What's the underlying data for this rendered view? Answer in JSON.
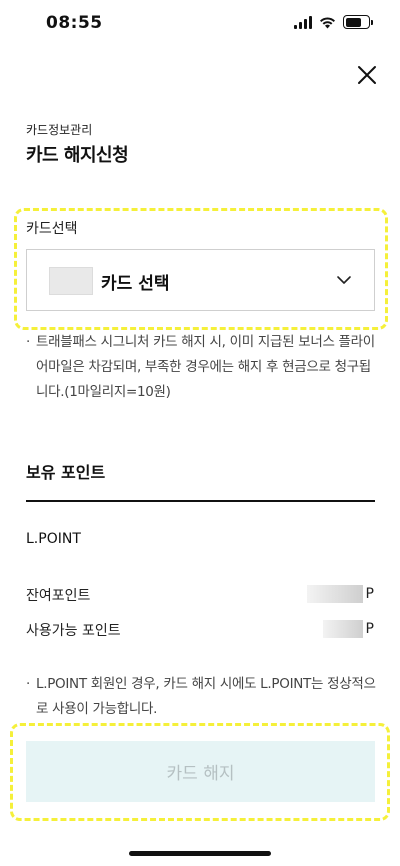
{
  "status_bar": {
    "time": "08:55"
  },
  "header": {
    "breadcrumb": "카드정보관리",
    "title": "카드 해지신청"
  },
  "card_select": {
    "label": "카드선택",
    "placeholder": "카드 선택"
  },
  "notice": {
    "bullet": "·",
    "text": "트래블패스 시그니처 카드 해지 시, 이미 지급된 보너스 플라이어마일은 차감되며, 부족한 경우에는 해지 후 현금으로 청구됩니다.(1마일리지=10원)"
  },
  "points": {
    "heading": "보유 포인트",
    "provider": "L.POINT",
    "rows": [
      {
        "label": "잔여포인트",
        "unit": "P"
      },
      {
        "label": "사용가능 포인트",
        "unit": "P"
      }
    ],
    "notice": "L.POINT 회원인 경우, 카드 해지 시에도 L.POINT는 정상적으로 사용이 가능합니다."
  },
  "actions": {
    "cancel_card_label": "카드 해지"
  },
  "colors": {
    "highlight": "#f5f03a",
    "button_bg": "#e6f4f5",
    "button_text": "#b5c0c2"
  }
}
